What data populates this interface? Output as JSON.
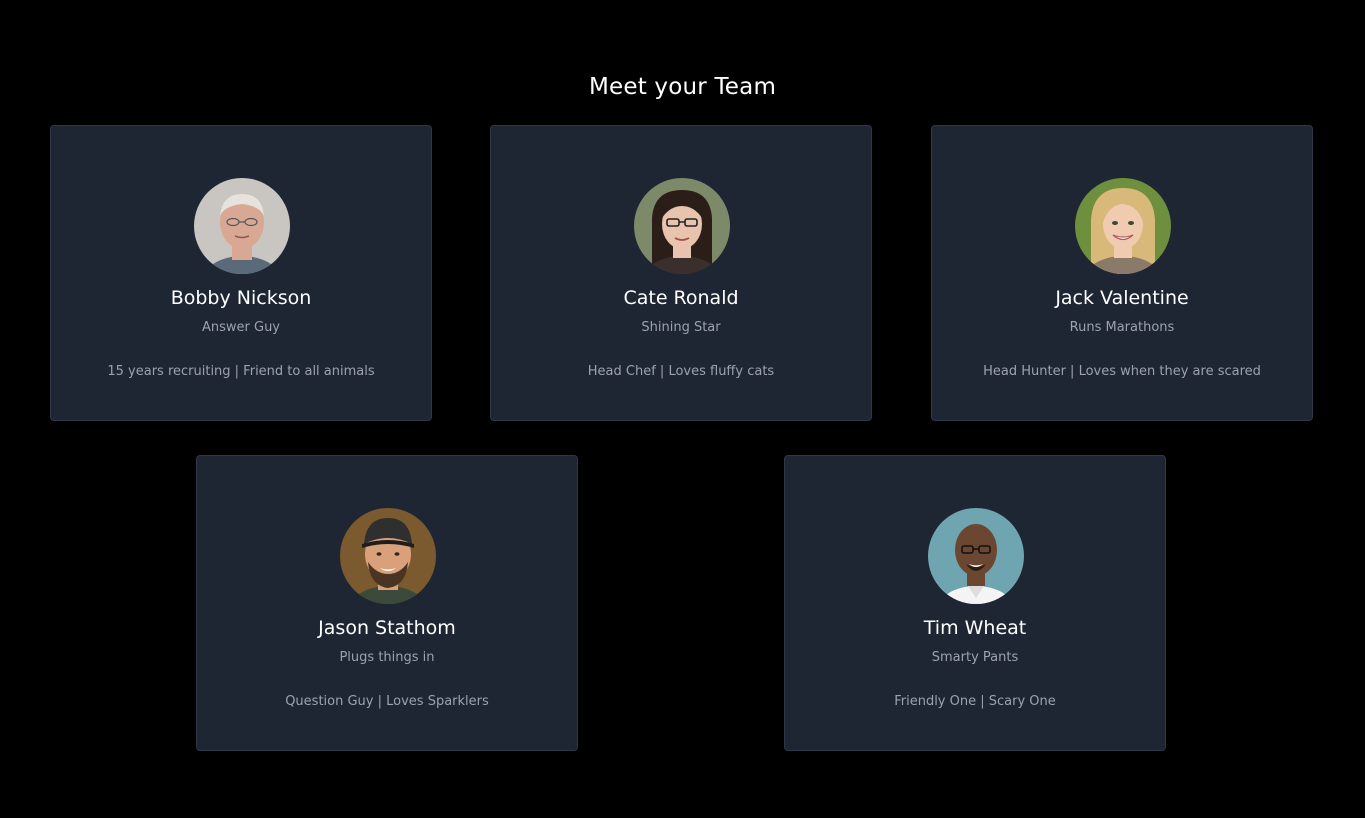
{
  "heading": "Meet your Team",
  "members": [
    {
      "name": "Bobby Nickson",
      "role": "Answer Guy",
      "bio": "15 years recruiting | Friend to all animals",
      "colors": {
        "bg": "#c9c6c2",
        "skin": "#d9a894",
        "hair": "#e6e2dc",
        "shirt": "#5a6a7a"
      }
    },
    {
      "name": "Cate Ronald",
      "role": "Shining Star",
      "bio": "Head Chef | Loves fluffy cats",
      "colors": {
        "bg": "#7d8a6a",
        "skin": "#e8c3ad",
        "hair": "#2b1e18",
        "shirt": "#3a2f2c"
      }
    },
    {
      "name": "Jack Valentine",
      "role": "Runs Marathons",
      "bio": "Head Hunter | Loves when they are scared",
      "colors": {
        "bg": "#6d8f3e",
        "skin": "#f0cbb0",
        "hair": "#d9b979",
        "shirt": "#8a7a6a"
      }
    },
    {
      "name": "Jason Stathom",
      "role": "Plugs things in",
      "bio": "Question Guy | Loves Sparklers",
      "colors": {
        "bg": "#7a5a2e",
        "skin": "#d9a07a",
        "hair": "#2f2f2f",
        "shirt": "#3b4a3a"
      }
    },
    {
      "name": "Tim Wheat",
      "role": "Smarty Pants",
      "bio": "Friendly One | Scary One",
      "colors": {
        "bg": "#6fa5b0",
        "skin": "#6b4630",
        "hair": "#2a1c14",
        "shirt": "#f4f4f4"
      }
    }
  ]
}
